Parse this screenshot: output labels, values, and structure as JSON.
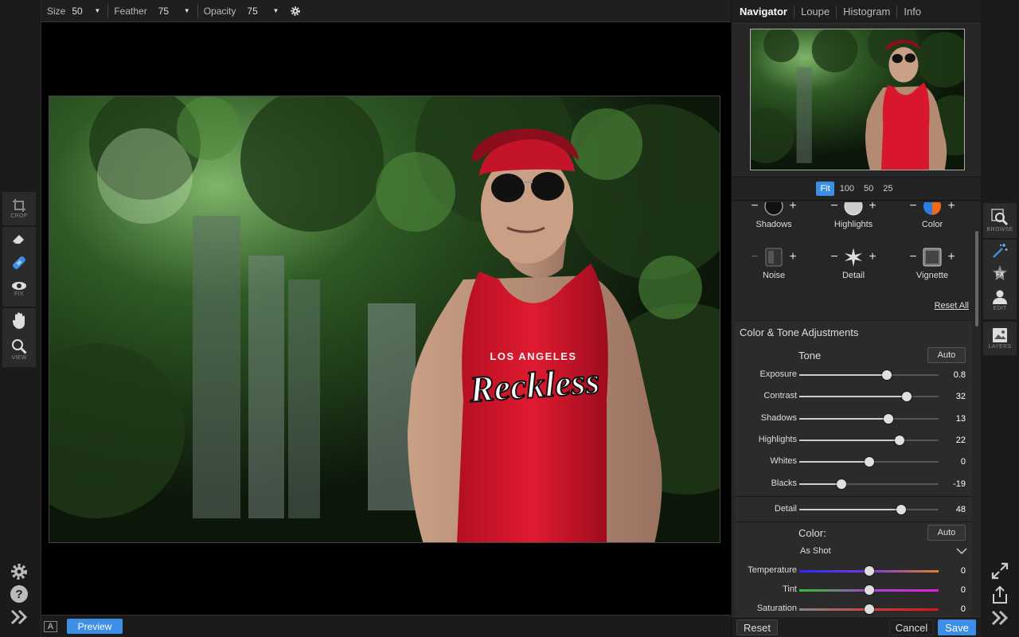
{
  "toolbar": {
    "size_label": "Size",
    "size_value": "50",
    "feather_label": "Feather",
    "feather_value": "75",
    "opacity_label": "Opacity",
    "opacity_value": "75"
  },
  "left_tools": {
    "crop": "CROP",
    "fix": "FIX",
    "view": "VIEW"
  },
  "right_tools": {
    "browse": "BROWSE",
    "edit": "EDIT",
    "layers": "LAYERS"
  },
  "photo_shirt": {
    "line1": "LOS ANGELES",
    "line2": "Reckless"
  },
  "navigator": {
    "tabs": [
      "Navigator",
      "Loupe",
      "Histogram",
      "Info"
    ],
    "zoom": [
      "Fit",
      "100",
      "50",
      "25"
    ]
  },
  "presets": {
    "row1": [
      "Shadows",
      "Highlights",
      "Color"
    ],
    "row2": [
      "Noise",
      "Detail",
      "Vignette"
    ],
    "reset_all": "Reset All"
  },
  "adjustments": {
    "title": "Color & Tone Adjustments",
    "tone_label": "Tone",
    "auto": "Auto",
    "tone": [
      {
        "label": "Exposure",
        "value": "0.8",
        "pos": 0.63
      },
      {
        "label": "Contrast",
        "value": "32",
        "pos": 0.77
      },
      {
        "label": "Shadows",
        "value": "13",
        "pos": 0.64
      },
      {
        "label": "Highlights",
        "value": "22",
        "pos": 0.72
      },
      {
        "label": "Whites",
        "value": "0",
        "pos": 0.5
      },
      {
        "label": "Blacks",
        "value": "-19",
        "pos": 0.3
      }
    ],
    "detail": {
      "label": "Detail",
      "value": "48",
      "pos": 0.73
    },
    "color_label": "Color:",
    "white_balance": "As Shot",
    "color": [
      {
        "label": "Temperature",
        "value": "0",
        "pos": 0.5
      },
      {
        "label": "Tint",
        "value": "0",
        "pos": 0.5
      },
      {
        "label": "Saturation",
        "value": "0",
        "pos": 0.5
      }
    ]
  },
  "bottom": {
    "a_badge": "A",
    "preview": "Preview",
    "reset": "Reset",
    "cancel": "Cancel",
    "save": "Save"
  }
}
